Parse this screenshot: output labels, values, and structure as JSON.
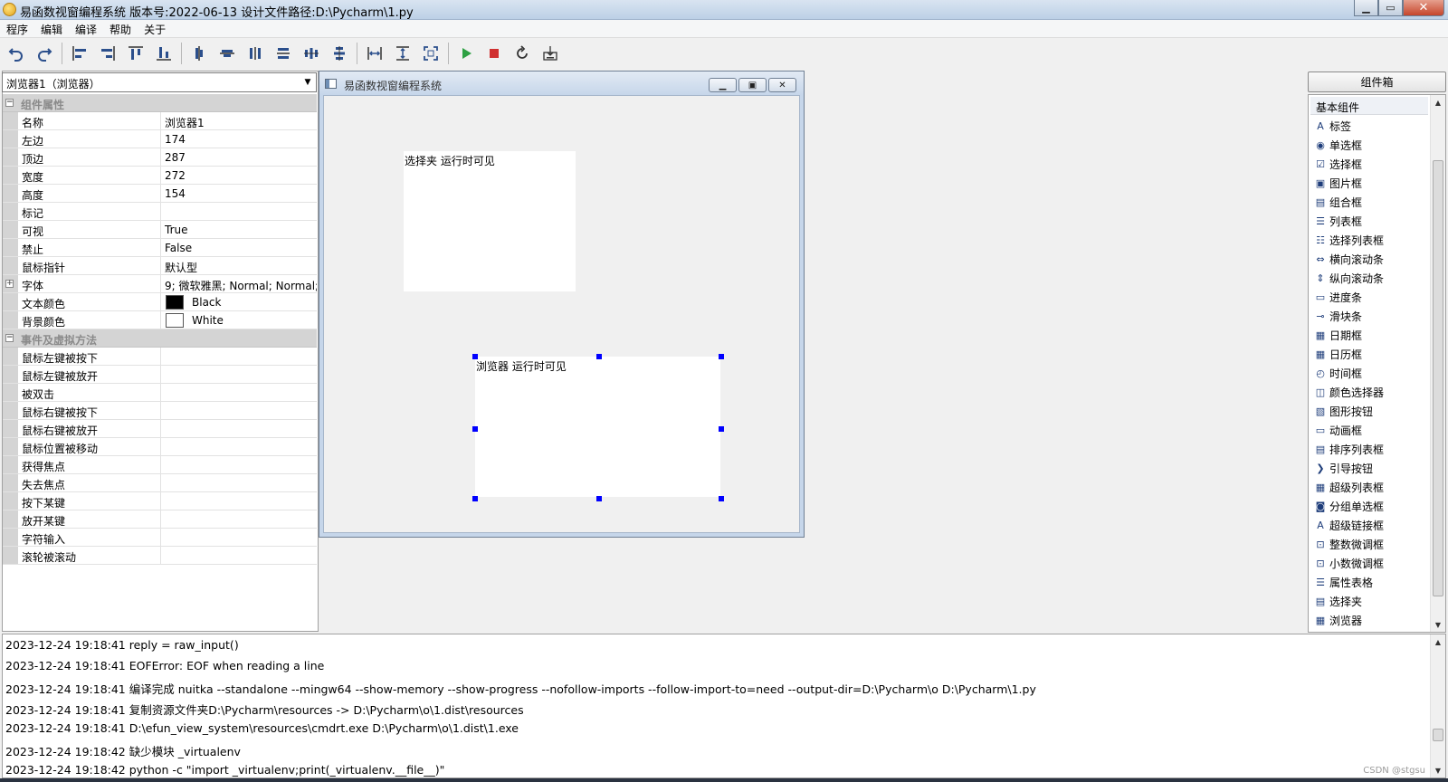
{
  "window": {
    "title": "易函数视窗编程系统 版本号:2022-06-13 设计文件路径:D:\\Pycharm\\1.py",
    "controls": {
      "minimize": "▁",
      "maximize": "▭",
      "close": "✕"
    }
  },
  "menu": [
    "程序",
    "编辑",
    "编译",
    "帮助",
    "关于"
  ],
  "toolbar": {
    "icons": [
      "undo-icon",
      "redo-icon",
      "align-left-icon",
      "align-right-icon",
      "align-top-icon",
      "align-bottom-icon",
      "center-vertical-icon",
      "center-horizontal-icon",
      "space-horizontal-icon",
      "space-vertical-icon",
      "distribute-horizontal-icon",
      "distribute-vertical-icon",
      "same-width-icon",
      "same-height-icon",
      "fit-size-icon",
      "run-icon",
      "stop-icon",
      "refresh-icon",
      "build-icon"
    ],
    "colors": {
      "icon": "#2b4f8c",
      "run": "#2ea043",
      "stop": "#d03030"
    }
  },
  "properties": {
    "selector": "浏览器1（浏览器）",
    "section_props": "组件属性",
    "rows": [
      {
        "key": "名称",
        "value": "浏览器1"
      },
      {
        "key": "左边",
        "value": "174"
      },
      {
        "key": "顶边",
        "value": "287"
      },
      {
        "key": "宽度",
        "value": "272"
      },
      {
        "key": "高度",
        "value": "154"
      },
      {
        "key": "标记",
        "value": ""
      },
      {
        "key": "可视",
        "value": "True"
      },
      {
        "key": "禁止",
        "value": "False"
      },
      {
        "key": "鼠标指针",
        "value": "默认型"
      },
      {
        "key": "字体",
        "value": "9; 微软雅黑; Normal; Normal;",
        "expandable": true
      },
      {
        "key": "文本颜色",
        "value": "Black",
        "swatch": "#000000"
      },
      {
        "key": "背景颜色",
        "value": "White",
        "swatch": "#ffffff"
      }
    ],
    "section_events": "事件及虚拟方法",
    "events": [
      "鼠标左键被按下",
      "鼠标左键被放开",
      "被双击",
      "鼠标右键被按下",
      "鼠标右键被放开",
      "鼠标位置被移动",
      "获得焦点",
      "失去焦点",
      "按下某键",
      "放开某键",
      "字符输入",
      "滚轮被滚动"
    ]
  },
  "form": {
    "title": "易函数视窗编程系统",
    "buttons": {
      "minimize": "▁",
      "maximize": "▣",
      "close": "✕"
    },
    "controls": [
      {
        "name": "tabbox-control",
        "text": "选择夹 运行时可见"
      },
      {
        "name": "browser-control",
        "text": "浏览器 运行时可见",
        "selected": true
      }
    ],
    "handle_color": "#0000ff"
  },
  "toolbox": {
    "button": "组件箱",
    "category": "基本组件",
    "items": [
      {
        "label": "标签",
        "icon": "label-icon",
        "glyph": "A"
      },
      {
        "label": "单选框",
        "icon": "radio-icon",
        "glyph": "◉"
      },
      {
        "label": "选择框",
        "icon": "checkbox-icon",
        "glyph": "☑"
      },
      {
        "label": "图片框",
        "icon": "picture-icon",
        "glyph": "▣"
      },
      {
        "label": "组合框",
        "icon": "combobox-icon",
        "glyph": "▤"
      },
      {
        "label": "列表框",
        "icon": "listbox-icon",
        "glyph": "☰"
      },
      {
        "label": "选择列表框",
        "icon": "checklist-icon",
        "glyph": "☷"
      },
      {
        "label": "横向滚动条",
        "icon": "hscroll-icon",
        "glyph": "⇔"
      },
      {
        "label": "纵向滚动条",
        "icon": "vscroll-icon",
        "glyph": "⇕"
      },
      {
        "label": "进度条",
        "icon": "progress-icon",
        "glyph": "▭"
      },
      {
        "label": "滑块条",
        "icon": "slider-icon",
        "glyph": "⊸"
      },
      {
        "label": "日期框",
        "icon": "date-icon",
        "glyph": "▦"
      },
      {
        "label": "日历框",
        "icon": "calendar-icon",
        "glyph": "▦"
      },
      {
        "label": "时间框",
        "icon": "clock-icon",
        "glyph": "◴"
      },
      {
        "label": "颜色选择器",
        "icon": "color-picker-icon",
        "glyph": "◫"
      },
      {
        "label": "图形按钮",
        "icon": "image-button-icon",
        "glyph": "▧"
      },
      {
        "label": "动画框",
        "icon": "animation-icon",
        "glyph": "▭"
      },
      {
        "label": "排序列表框",
        "icon": "sort-list-icon",
        "glyph": "▤"
      },
      {
        "label": "引导按钮",
        "icon": "guide-button-icon",
        "glyph": "❯"
      },
      {
        "label": "超级列表框",
        "icon": "super-list-icon",
        "glyph": "▦"
      },
      {
        "label": "分组单选框",
        "icon": "group-radio-icon",
        "glyph": "◙"
      },
      {
        "label": "超级链接框",
        "icon": "hyperlink-icon",
        "glyph": "A"
      },
      {
        "label": "整数微调框",
        "icon": "int-spin-icon",
        "glyph": "⊡"
      },
      {
        "label": "小数微调框",
        "icon": "float-spin-icon",
        "glyph": "⊡"
      },
      {
        "label": "属性表格",
        "icon": "property-grid-icon",
        "glyph": "☰"
      },
      {
        "label": "选择夹",
        "icon": "tab-icon",
        "glyph": "▤"
      },
      {
        "label": "浏览器",
        "icon": "browser-icon",
        "glyph": "▦"
      }
    ]
  },
  "log": [
    "2023-12-24 19:18:41 reply = raw_input()",
    "2023-12-24 19:18:41 EOFError: EOF when reading a line",
    "2023-12-24 19:18:41 编译完成 nuitka --standalone --mingw64 --show-memory --show-progress --nofollow-imports --follow-import-to=need --output-dir=D:\\Pycharm\\o D:\\Pycharm\\1.py",
    "2023-12-24 19:18:41 复制资源文件夹D:\\Pycharm\\resources -> D:\\Pycharm\\o\\1.dist\\resources",
    "2023-12-24 19:18:41 D:\\efun_view_system\\resources\\cmdrt.exe D:\\Pycharm\\o\\1.dist\\1.exe",
    "2023-12-24 19:18:42 缺少模块 _virtualenv",
    "2023-12-24 19:18:42 python -c \"import _virtualenv;print(_virtualenv.__file__)\""
  ],
  "watermark": "CSDN @stgsu"
}
